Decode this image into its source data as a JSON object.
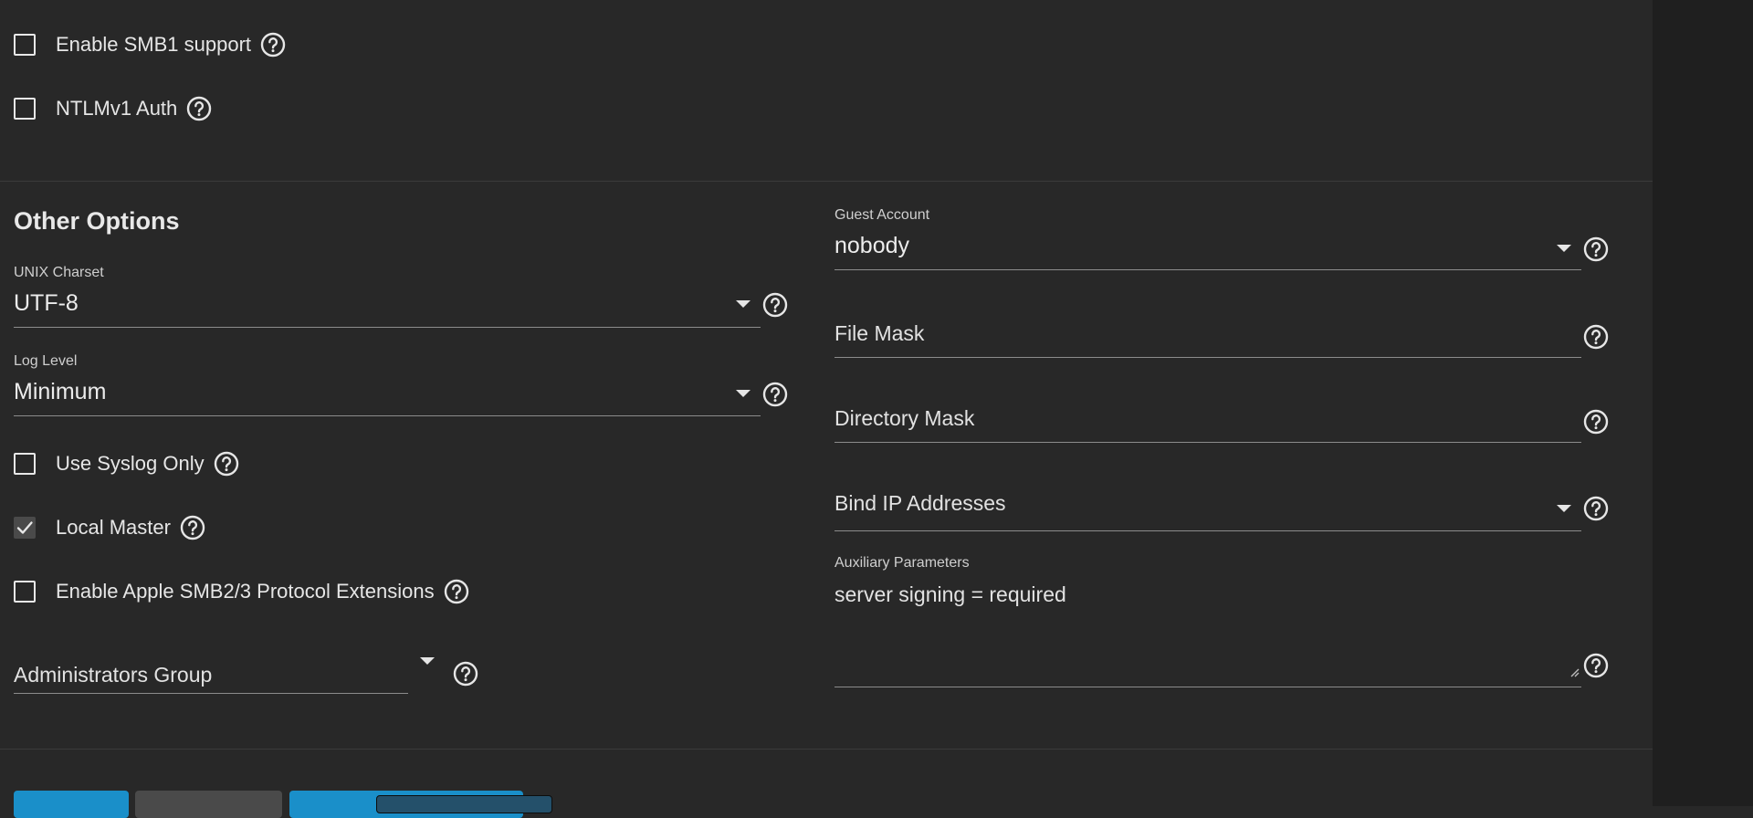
{
  "smb": {
    "enable_smb1": {
      "label": "Enable SMB1 support",
      "checked": false
    },
    "ntlmv1": {
      "label": "NTLMv1 Auth",
      "checked": false
    }
  },
  "other_options": {
    "title": "Other Options",
    "unix_charset": {
      "label": "UNIX Charset",
      "value": "UTF-8"
    },
    "log_level": {
      "label": "Log Level",
      "value": "Minimum"
    },
    "use_syslog_only": {
      "label": "Use Syslog Only",
      "checked": false
    },
    "local_master": {
      "label": "Local Master",
      "checked": true
    },
    "apple_extensions": {
      "label": "Enable Apple SMB2/3 Protocol Extensions",
      "checked": false
    },
    "administrators_group": {
      "placeholder": "Administrators Group"
    },
    "guest_account": {
      "label": "Guest Account",
      "value": "nobody"
    },
    "file_mask": {
      "placeholder": "File Mask"
    },
    "directory_mask": {
      "placeholder": "Directory Mask"
    },
    "bind_ip": {
      "placeholder": "Bind IP Addresses"
    },
    "auxiliary_parameters": {
      "label": "Auxiliary Parameters",
      "value": "server signing = required"
    }
  },
  "colors": {
    "background": "#282828",
    "gutter": "#1f1f1f",
    "primary_button": "#1a8fc9",
    "secondary_button": "#4a4a4a"
  },
  "icons": [
    "help-icon",
    "check-icon",
    "dropdown-caret-icon",
    "resize-handle-icon"
  ]
}
